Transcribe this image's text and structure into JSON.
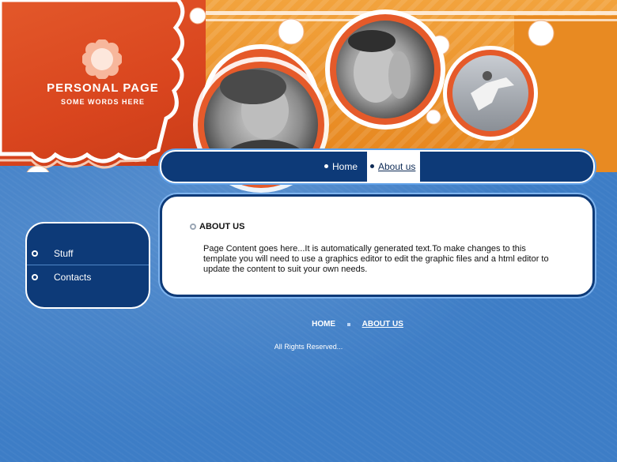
{
  "header": {
    "site_title": "PERSONAL PAGE",
    "site_subtitle": "SOME WORDS HERE"
  },
  "nav": {
    "items": [
      {
        "label": "Home",
        "active": false
      },
      {
        "label": "About us",
        "active": true
      }
    ]
  },
  "sidebar": {
    "items": [
      {
        "label": "Stuff"
      },
      {
        "label": "Contacts"
      }
    ]
  },
  "content": {
    "heading": "ABOUT US",
    "body": "Page Content goes here...It is automatically generated text.To make changes to this template you will need to use a graphics editor to edit the graphic files and a html editor to update the content to suit your own needs."
  },
  "footer": {
    "links": [
      {
        "label": "HOME"
      },
      {
        "label": "ABOUT US"
      }
    ],
    "copyright": "All Rights Reserved..."
  },
  "colors": {
    "background_blue": "#3d7dc6",
    "nav_navy": "#0d3a78",
    "header_red": "#d9451e",
    "header_orange": "#e88a22"
  }
}
